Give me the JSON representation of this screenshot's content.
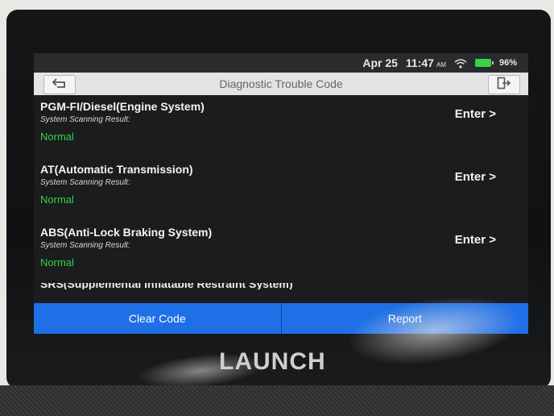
{
  "status": {
    "date": "Apr 25",
    "time": "11:47",
    "ampm": "AM",
    "battery": "96%"
  },
  "header": {
    "title": "Diagnostic Trouble Code",
    "back_icon": "back-arrow-icon",
    "exit_icon": "exit-icon"
  },
  "systems": [
    {
      "name": "PGM-FI/Diesel(Engine System)",
      "subtitle": "System Scanning Result:",
      "status": "Normal",
      "action": "Enter >"
    },
    {
      "name": "AT(Automatic Transmission)",
      "subtitle": "System Scanning Result:",
      "status": "Normal",
      "action": "Enter >"
    },
    {
      "name": "ABS(Anti-Lock Braking System)",
      "subtitle": "System Scanning Result:",
      "status": "Normal",
      "action": "Enter >"
    }
  ],
  "partial_item": "SRS(Supplemental Inflatable Restraint System)",
  "footer": {
    "clear_label": "Clear Code",
    "report_label": "Report"
  },
  "device": {
    "brand": "LAUNCH"
  },
  "colors": {
    "status_normal": "#35d24a",
    "button_blue": "#1f6fe6"
  }
}
